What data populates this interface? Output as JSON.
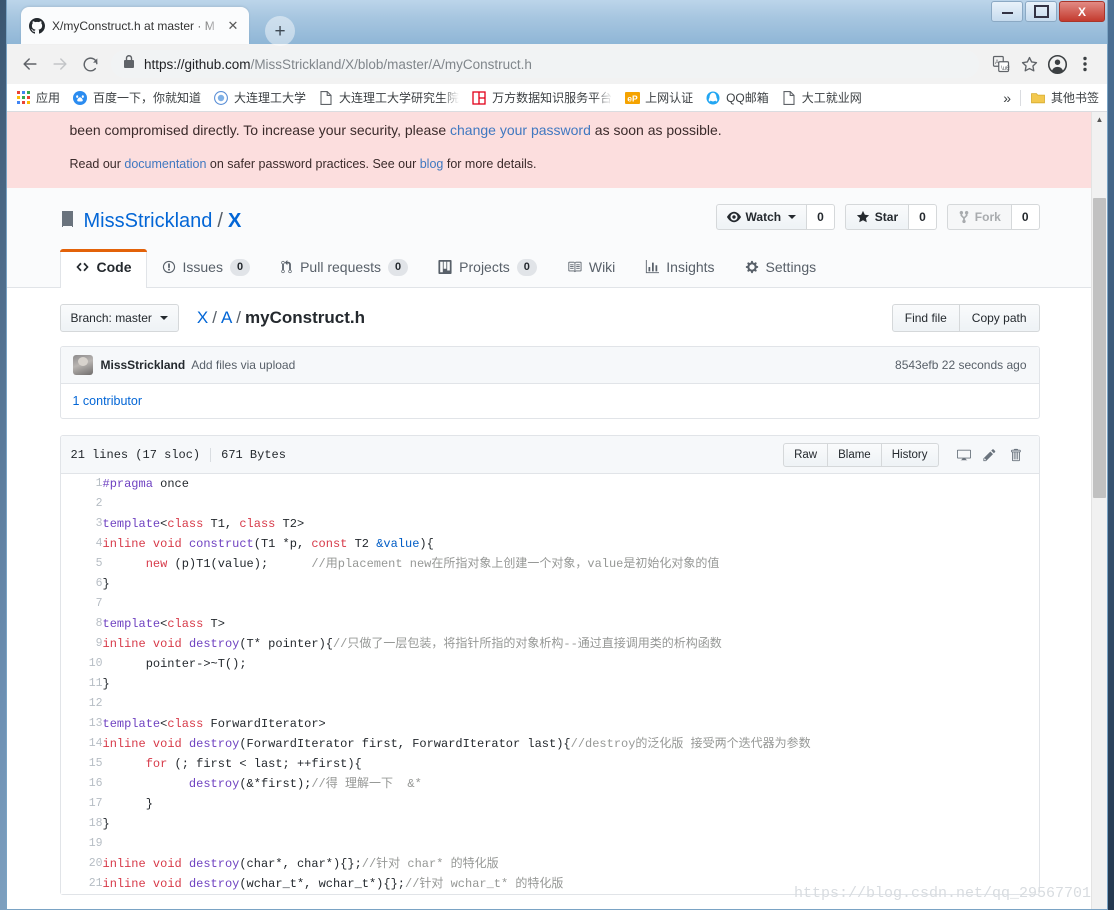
{
  "window": {
    "controls": {
      "minimize": "minimize",
      "maximize": "maximize",
      "close": "X"
    }
  },
  "browser": {
    "tab": {
      "title": "X/myConstruct.h at master · M",
      "favicon": "github-icon",
      "close": "✕"
    },
    "new_tab": "+",
    "nav": {
      "back": "←",
      "forward": "→",
      "reload": "⟳"
    },
    "omnibox": {
      "lock": "lock-icon",
      "url_bold": "https://github.com",
      "url_dim": "/MissStrickland/X/blob/master/A/myConstruct.h",
      "full_url": "https://github.com/MissStrickland/X/blob/master/A/myConstruct.h"
    },
    "actions": {
      "translate": "translate-icon",
      "bookmark": "star-icon",
      "profile": "avatar-icon",
      "menu": "kebab-menu-icon"
    },
    "bookmarks": [
      {
        "label": "应用",
        "icon": "apps-grid-icon"
      },
      {
        "label": "百度一下，你就知道",
        "icon": "baidu-icon"
      },
      {
        "label": "大连理工大学",
        "icon": "dlut-icon"
      },
      {
        "label": "大连理工大学研究生院",
        "icon": "page-icon"
      },
      {
        "label": "万方数据知识服务平台",
        "icon": "wanfang-icon"
      },
      {
        "label": "上网认证",
        "icon": "ep-icon"
      },
      {
        "label": "QQ邮箱",
        "icon": "qqmail-icon"
      },
      {
        "label": "大工就业网",
        "icon": "page-icon"
      }
    ],
    "overflow": "»",
    "other_bookmarks": {
      "label": "其他书签",
      "icon": "folder-icon"
    }
  },
  "banner": {
    "line1_a": "been compromised directly. To increase your security, please ",
    "line1_link": "change your password",
    "line1_b": " as soon as possible.",
    "line2_a": "Read our ",
    "line2_link1": "documentation",
    "line2_b": " on safer password practices. See our ",
    "line2_link2": "blog",
    "line2_c": " for more details."
  },
  "repo": {
    "icon": "repo-book-icon",
    "owner": "MissStrickland",
    "separator": "/",
    "name": "X",
    "actions": [
      {
        "label": "Watch",
        "icon": "eye-icon",
        "count": "0",
        "has_caret": true,
        "disabled": false
      },
      {
        "label": "Star",
        "icon": "star-filled-icon",
        "count": "0",
        "has_caret": false,
        "disabled": false
      },
      {
        "label": "Fork",
        "icon": "fork-icon",
        "count": "0",
        "has_caret": false,
        "disabled": true
      }
    ],
    "tabs": [
      {
        "label": "Code",
        "icon": "code-icon",
        "count": null,
        "active": true
      },
      {
        "label": "Issues",
        "icon": "issue-opened-icon",
        "count": "0",
        "active": false
      },
      {
        "label": "Pull requests",
        "icon": "git-pull-request-icon",
        "count": "0",
        "active": false
      },
      {
        "label": "Projects",
        "icon": "project-board-icon",
        "count": "0",
        "active": false
      },
      {
        "label": "Wiki",
        "icon": "book-icon",
        "count": null,
        "active": false
      },
      {
        "label": "Insights",
        "icon": "graph-icon",
        "count": null,
        "active": false
      },
      {
        "label": "Settings",
        "icon": "gear-icon",
        "count": null,
        "active": false
      }
    ]
  },
  "file": {
    "branch_button": "Branch: master",
    "breadcrumb": {
      "root": "X",
      "folder": "A",
      "filename": "myConstruct.h"
    },
    "find_file": "Find file",
    "copy_path": "Copy path",
    "commit": {
      "author": "MissStrickland",
      "message": "Add files via upload",
      "sha": "8543efb",
      "time": "22 seconds ago"
    },
    "contributors": "1 contributor",
    "stats": {
      "lines": "21 lines (17 sloc)",
      "size": "671 Bytes"
    },
    "blob_buttons": [
      "Raw",
      "Blame",
      "History"
    ],
    "blob_icons": [
      "desktop-download-icon",
      "pencil-edit-icon",
      "trash-delete-icon"
    ]
  },
  "code": {
    "language": "cpp",
    "lines": [
      {
        "n": "1",
        "tokens": [
          {
            "t": "#pragma",
            "c": "kp"
          },
          {
            "t": " once",
            "c": "pn"
          }
        ]
      },
      {
        "n": "2",
        "tokens": []
      },
      {
        "n": "3",
        "tokens": [
          {
            "t": "template",
            "c": "fn"
          },
          {
            "t": "<",
            "c": "pn"
          },
          {
            "t": "class",
            "c": "k"
          },
          {
            "t": " T1, ",
            "c": "pn"
          },
          {
            "t": "class",
            "c": "k"
          },
          {
            "t": " T2>",
            "c": "pn"
          }
        ]
      },
      {
        "n": "4",
        "tokens": [
          {
            "t": "inline",
            "c": "k"
          },
          {
            "t": " ",
            "c": "pn"
          },
          {
            "t": "void",
            "c": "k"
          },
          {
            "t": " ",
            "c": "pn"
          },
          {
            "t": "construct",
            "c": "fn"
          },
          {
            "t": "(T1 *p, ",
            "c": "pn"
          },
          {
            "t": "const",
            "c": "k"
          },
          {
            "t": " T2 ",
            "c": "pn"
          },
          {
            "t": "&value",
            "c": "ty"
          },
          {
            "t": "){",
            "c": "pn"
          }
        ]
      },
      {
        "n": "5",
        "tokens": [
          {
            "t": "      ",
            "c": "pn"
          },
          {
            "t": "new",
            "c": "k"
          },
          {
            "t": " (p)T1(value);      ",
            "c": "pn"
          },
          {
            "t": "//用placement new在所指对象上创建一个对象，value是初始化对象的值",
            "c": "cm"
          }
        ]
      },
      {
        "n": "6",
        "tokens": [
          {
            "t": "}",
            "c": "pn"
          }
        ]
      },
      {
        "n": "7",
        "tokens": []
      },
      {
        "n": "8",
        "tokens": [
          {
            "t": "template",
            "c": "fn"
          },
          {
            "t": "<",
            "c": "pn"
          },
          {
            "t": "class",
            "c": "k"
          },
          {
            "t": " T>",
            "c": "pn"
          }
        ]
      },
      {
        "n": "9",
        "tokens": [
          {
            "t": "inline",
            "c": "k"
          },
          {
            "t": " ",
            "c": "pn"
          },
          {
            "t": "void",
            "c": "k"
          },
          {
            "t": " ",
            "c": "pn"
          },
          {
            "t": "destroy",
            "c": "fn"
          },
          {
            "t": "(T* pointer){",
            "c": "pn"
          },
          {
            "t": "//只做了一层包装，将指针所指的对象析构--通过直接调用类的析构函数",
            "c": "cm"
          }
        ]
      },
      {
        "n": "10",
        "tokens": [
          {
            "t": "      pointer->~T();",
            "c": "pn"
          }
        ]
      },
      {
        "n": "11",
        "tokens": [
          {
            "t": "}",
            "c": "pn"
          }
        ]
      },
      {
        "n": "12",
        "tokens": []
      },
      {
        "n": "13",
        "tokens": [
          {
            "t": "template",
            "c": "fn"
          },
          {
            "t": "<",
            "c": "pn"
          },
          {
            "t": "class",
            "c": "k"
          },
          {
            "t": " ForwardIterator>",
            "c": "pn"
          }
        ]
      },
      {
        "n": "14",
        "tokens": [
          {
            "t": "inline",
            "c": "k"
          },
          {
            "t": " ",
            "c": "pn"
          },
          {
            "t": "void",
            "c": "k"
          },
          {
            "t": " ",
            "c": "pn"
          },
          {
            "t": "destroy",
            "c": "fn"
          },
          {
            "t": "(ForwardIterator first, ForwardIterator last){",
            "c": "pn"
          },
          {
            "t": "//destroy的泛化版 接受两个迭代器为参数",
            "c": "cm"
          }
        ]
      },
      {
        "n": "15",
        "tokens": [
          {
            "t": "      ",
            "c": "pn"
          },
          {
            "t": "for",
            "c": "k"
          },
          {
            "t": " (; first < last; ++first){",
            "c": "pn"
          }
        ]
      },
      {
        "n": "16",
        "tokens": [
          {
            "t": "            ",
            "c": "pn"
          },
          {
            "t": "destroy",
            "c": "fn"
          },
          {
            "t": "(&*first);",
            "c": "pn"
          },
          {
            "t": "//得 理解一下  &*",
            "c": "cm"
          }
        ]
      },
      {
        "n": "17",
        "tokens": [
          {
            "t": "      }",
            "c": "pn"
          }
        ]
      },
      {
        "n": "18",
        "tokens": [
          {
            "t": "}",
            "c": "pn"
          }
        ]
      },
      {
        "n": "19",
        "tokens": []
      },
      {
        "n": "20",
        "tokens": [
          {
            "t": "inline",
            "c": "k"
          },
          {
            "t": " ",
            "c": "pn"
          },
          {
            "t": "void",
            "c": "k"
          },
          {
            "t": " ",
            "c": "pn"
          },
          {
            "t": "destroy",
            "c": "fn"
          },
          {
            "t": "(char*, char*){};",
            "c": "pn"
          },
          {
            "t": "//针对 char* 的特化版",
            "c": "cm"
          }
        ]
      },
      {
        "n": "21",
        "tokens": [
          {
            "t": "inline",
            "c": "k"
          },
          {
            "t": " ",
            "c": "pn"
          },
          {
            "t": "void",
            "c": "k"
          },
          {
            "t": " ",
            "c": "pn"
          },
          {
            "t": "destroy",
            "c": "fn"
          },
          {
            "t": "(wchar_t*, wchar_t*){};",
            "c": "pn"
          },
          {
            "t": "//针对 wchar_t* 的特化版",
            "c": "cm"
          }
        ]
      }
    ]
  },
  "watermark": "https://blog.csdn.net/qq_29567701",
  "colors": {
    "accent_orange": "#e36209",
    "link_blue": "#0366d6",
    "banner_pink": "#fcdede",
    "keyword_red": "#d73a49",
    "function_purple": "#6f42c1",
    "type_blue": "#005cc5",
    "comment_gray": "#969896"
  }
}
